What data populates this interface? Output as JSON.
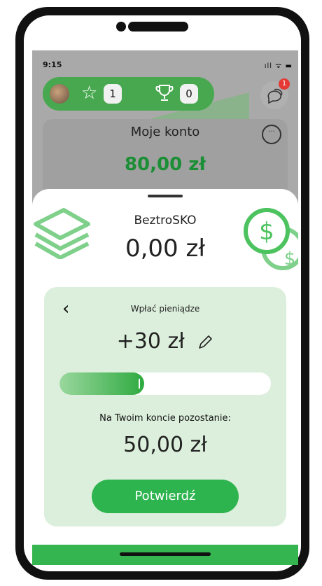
{
  "status_bar": {
    "time": "9:15",
    "icons": "ıll ᯤ ▬"
  },
  "topbar": {
    "stars_count": "1",
    "trophies_count": "0",
    "notifications_badge": "1"
  },
  "account": {
    "title": "Moje konto",
    "amount": "80,00 zł",
    "more": "···"
  },
  "sheet": {
    "title": "BeztroSKO",
    "balance": "0,00 zł"
  },
  "deposit": {
    "back": "‹",
    "title": "Wpłać pieniądze",
    "amount": "+30 zł",
    "slider_fraction": 0.4,
    "remaining_label": "Na Twoim koncie pozostanie:",
    "remaining_amount": "50,00 zł",
    "confirm_label": "Potwierdź"
  },
  "colors": {
    "brand_green": "#35b54f",
    "panel_bg": "#dcefdc",
    "amount_green": "#1b8e36",
    "badge_red": "#e53935"
  }
}
